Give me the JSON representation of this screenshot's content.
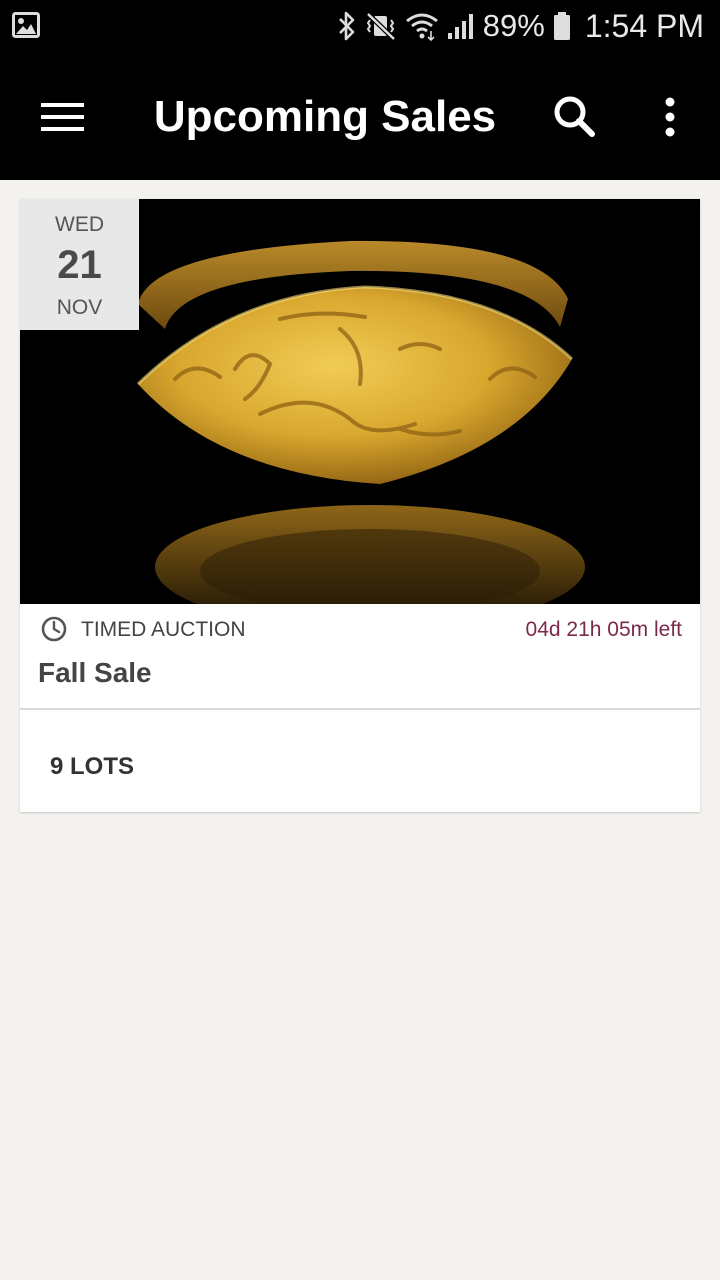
{
  "status_bar": {
    "battery_percent": "89%",
    "time": "1:54 PM"
  },
  "app_bar": {
    "title": "Upcoming Sales",
    "icons": [
      "menu-icon",
      "search-icon",
      "more-vert-icon"
    ]
  },
  "sale": {
    "date": {
      "weekday": "WED",
      "day": "21",
      "month": "NOV"
    },
    "type": "TIMED AUCTION",
    "time_left": "04d 21h 05m left",
    "title": "Fall Sale",
    "lots": "9 LOTS"
  },
  "colors": {
    "app_bar": "#000000",
    "background": "#f3f2ef",
    "time_left": "#7a2b4c",
    "date_badge": "#e8e8e8"
  }
}
